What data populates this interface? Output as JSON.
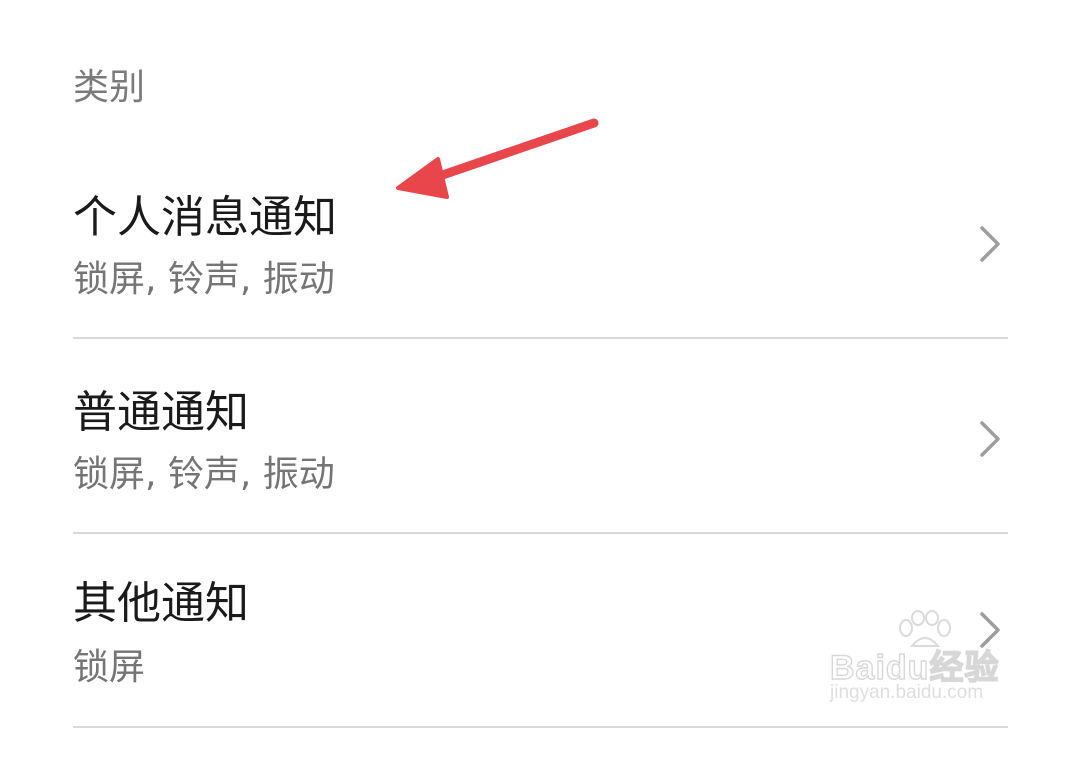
{
  "section": {
    "title": "类别"
  },
  "items": [
    {
      "title": "个人消息通知",
      "subtitle": "锁屏, 铃声, 振动"
    },
    {
      "title": "普通通知",
      "subtitle": "锁屏, 铃声, 振动"
    },
    {
      "title": "其他通知",
      "subtitle": "锁屏"
    }
  ],
  "annotation": {
    "icon": "arrow-icon",
    "color": "#e8464a"
  },
  "watermark": {
    "brand": "Baidu经验",
    "url": "jingyan.baidu.com"
  },
  "colors": {
    "title": "#1a1a1a",
    "subtitle": "#757575",
    "header": "#7a7a7a",
    "divider": "#d9d9d9",
    "chevron": "#9e9e9e"
  }
}
